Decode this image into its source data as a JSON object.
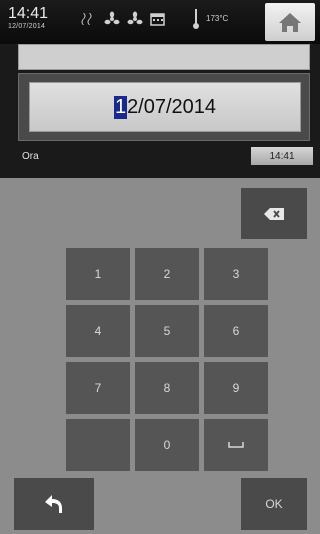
{
  "status": {
    "time": "14:41",
    "date": "12/07/2014",
    "temperature": "173°C",
    "icons": [
      "fan-pair-icon",
      "fan-icon",
      "fan-icon",
      "calendar-icon",
      "thermometer-icon"
    ]
  },
  "editor": {
    "top_field_value": "",
    "date_first_char": "1",
    "date_rest": "2/07/2014"
  },
  "ora": {
    "label": "Ora",
    "value": "14:41"
  },
  "keypad": {
    "keys": [
      "1",
      "2",
      "3",
      "4",
      "5",
      "6",
      "7",
      "8",
      "9",
      "",
      "0",
      "␣"
    ],
    "ok_label": "OK"
  }
}
